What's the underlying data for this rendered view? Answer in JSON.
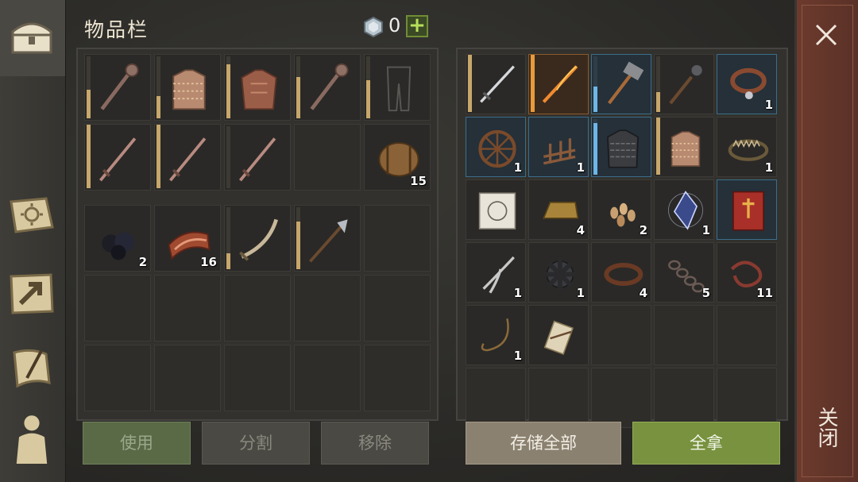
{
  "header": {
    "title": "物品栏",
    "gem_count": "0",
    "plus_label": "+"
  },
  "left_menu": [
    "chest-icon",
    "sun-map-icon",
    "arrow-map-icon",
    "scroll-quill-icon",
    "character-icon"
  ],
  "inventory": {
    "slots": [
      {
        "item": "mace",
        "durability": 0.45
      },
      {
        "item": "chainmail",
        "durability": 0.35
      },
      {
        "item": "leather-armor",
        "durability": 0.85
      },
      {
        "item": "mace",
        "durability": 0.65
      },
      {
        "item": "pants",
        "durability": 0.6
      },
      {
        "item": "sword",
        "durability": 1.0
      },
      {
        "item": "sword",
        "durability": 1.0
      },
      {
        "item": "sword",
        "durability": 0
      },
      {
        "item": "empty"
      },
      {
        "item": "barrel",
        "count": "15"
      }
    ],
    "slots_lower": [
      {
        "item": "coal",
        "count": "2"
      },
      {
        "item": "bacon",
        "count": "16"
      },
      {
        "item": "scimitar",
        "durability": 0.25
      },
      {
        "item": "halberd",
        "durability": 0.75
      },
      {
        "item": "empty"
      }
    ]
  },
  "storage": {
    "slots": [
      {
        "item": "longsword",
        "durability": 1.0
      },
      {
        "item": "flame-sword",
        "durability": 1.0,
        "rarity": "epic"
      },
      {
        "item": "hammer",
        "durability": 0.45,
        "rarity": "rare"
      },
      {
        "item": "flail",
        "durability": 0.35
      },
      {
        "item": "collar",
        "count": "1",
        "rarity": "rare"
      },
      {
        "item": "wheel",
        "count": "1",
        "rarity": "rare"
      },
      {
        "item": "sled-frame",
        "count": "1",
        "rarity": "rare"
      },
      {
        "item": "scale-armor",
        "durability": 0.9,
        "rarity": "rare"
      },
      {
        "item": "chainmail",
        "durability": 1.0
      },
      {
        "item": "bear-trap",
        "count": "1"
      },
      {
        "item": "blueprint"
      },
      {
        "item": "ingot",
        "count": "4"
      },
      {
        "item": "seeds",
        "count": "2"
      },
      {
        "item": "crystal",
        "count": "1"
      },
      {
        "item": "red-book",
        "rarity": "rare"
      },
      {
        "item": "slingshot-frame",
        "count": "1"
      },
      {
        "item": "gear",
        "count": "1"
      },
      {
        "item": "leather-belt",
        "count": "4"
      },
      {
        "item": "chain",
        "count": "5"
      },
      {
        "item": "rope-scraps",
        "count": "11"
      },
      {
        "item": "rope",
        "count": "1"
      },
      {
        "item": "scroll-bundle"
      }
    ]
  },
  "buttons": {
    "use": "使用",
    "split": "分割",
    "remove": "移除",
    "store_all": "存储全部",
    "take_all": "全拿"
  },
  "close_label": "关闭",
  "colors": {
    "accent_green": "#78923f",
    "close_panel": "#6d3a2d",
    "rare_border": "#3b6e8c",
    "durability": "#c7a76b"
  }
}
